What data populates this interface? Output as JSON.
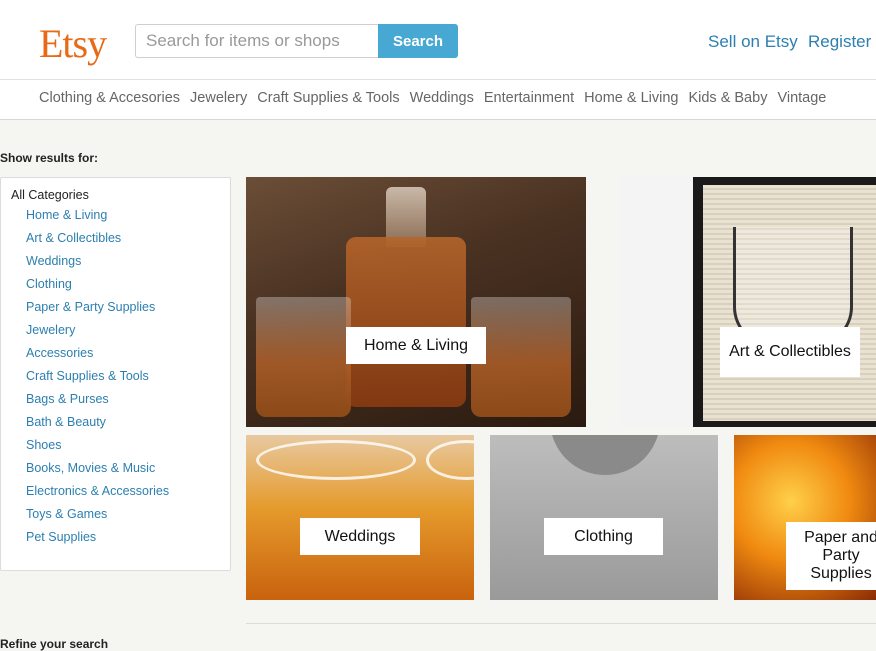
{
  "header": {
    "logo": "Etsy",
    "search_placeholder": "Search for items or shops",
    "search_button": "Search",
    "sell_link": "Sell on Etsy",
    "register_link": "Register"
  },
  "category_nav": [
    "Clothing & Accesories",
    "Jewelery",
    "Craft Supplies & Tools",
    "Weddings",
    "Entertainment",
    "Home & Living",
    "Kids & Baby",
    "Vintage"
  ],
  "sidebar": {
    "heading": "Show results for:",
    "all_label": "All Categories",
    "items": [
      "Home & Living",
      "Art & Collectibles",
      "Weddings",
      "Clothing",
      "Paper & Party Supplies",
      "Jewelery",
      "Accessories",
      "Craft Supplies & Tools",
      "Bags & Purses",
      "Bath & Beauty",
      "Shoes",
      "Books, Movies & Music",
      "Electronics & Accessories",
      "Toys & Games",
      "Pet Supplies"
    ],
    "refine_heading": "Refine your search"
  },
  "tiles": {
    "home": "Home & Living",
    "art": "Art & Collectibles",
    "weddings": "Weddings",
    "clothing": "Clothing",
    "paper": "Paper and Party Supplies"
  },
  "colors": {
    "brand": "#e86a16",
    "link": "#2c7fb0",
    "search_button": "#47a8d3",
    "page_background": "#f5f5f1"
  }
}
